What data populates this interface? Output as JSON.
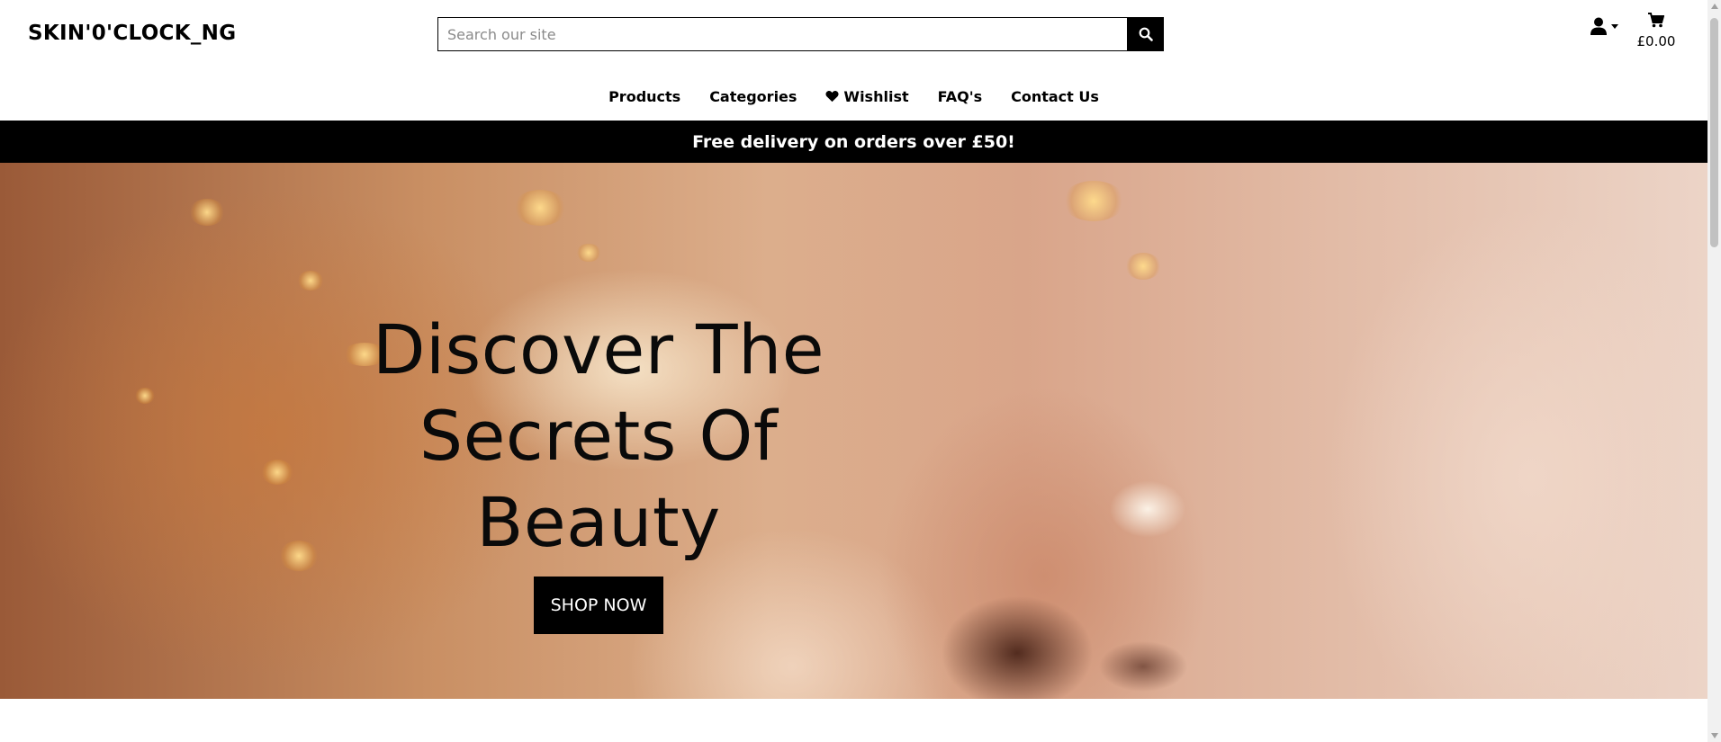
{
  "header": {
    "brand": "SKIN'0'CLOCK_NG",
    "search_placeholder": "Search our site",
    "search_icon": "search-icon",
    "account_icon": "user-icon",
    "cart_icon": "shopping-cart-icon",
    "cart_total": "£0.00"
  },
  "nav": {
    "items": [
      {
        "label": "Products"
      },
      {
        "label": "Categories"
      },
      {
        "label": "Wishlist",
        "icon": "heart-icon"
      },
      {
        "label": "FAQ's"
      },
      {
        "label": "Contact Us"
      }
    ]
  },
  "banner": {
    "text": "Free delivery on orders over £50!"
  },
  "hero": {
    "title_line1": "Discover The",
    "title_line2": "Secrets Of",
    "title_line3": "Beauty",
    "cta_label": "SHOP NOW"
  },
  "colors": {
    "brand_black": "#000000",
    "banner_text": "#ffffff"
  }
}
